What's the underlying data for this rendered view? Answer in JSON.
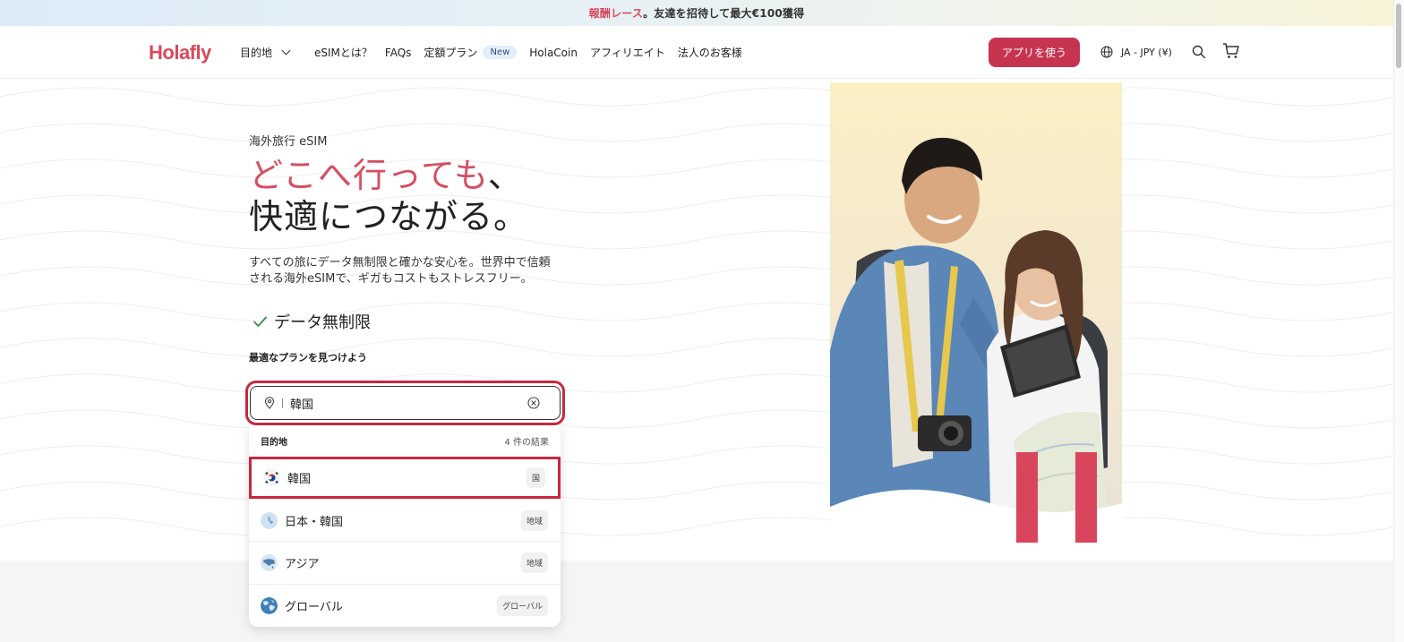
{
  "promo": {
    "accent": "報酬レース",
    "rest": "。友達を招待して最大€100獲得"
  },
  "header": {
    "logo": "Holafly",
    "nav": [
      {
        "label": "目的地"
      },
      {
        "label": "eSIMとは？"
      },
      {
        "label": "FAQs"
      },
      {
        "label": "定額プラン",
        "badge": "New"
      },
      {
        "label": "HolaCoin"
      },
      {
        "label": "アフィリエイト"
      },
      {
        "label": "法人のお客様"
      }
    ],
    "app_button": "アプリを使う",
    "language": "JA - JPY (¥)"
  },
  "hero": {
    "eyebrow": "海外旅行 eSIM",
    "headline_pink": "どこへ行っても",
    "headline_comma": "、",
    "headline_line2": "快適につながる。",
    "description": "すべての旅にデータ無制限と確かな安心を。世界中で信頼される海外eSIMで、ギガもコストもストレスフリー。",
    "feature": "データ無制限",
    "find_label": "最適なプランを見つけよう"
  },
  "search": {
    "value": "韓国"
  },
  "dropdown": {
    "heading": "目的地",
    "count": "4 件の結果",
    "items": [
      {
        "name": "韓国",
        "tag": "国",
        "flag": "korea-flag"
      },
      {
        "name": "日本・韓国",
        "tag": "地域",
        "flag": "globe-japan-korea"
      },
      {
        "name": "アジア",
        "tag": "地域",
        "flag": "globe-asia"
      },
      {
        "name": "グローバル",
        "tag": "グローバル",
        "flag": "globe-world"
      }
    ]
  },
  "colors": {
    "brand": "#d84a5c",
    "button": "#c73450",
    "highlight": "#c8283f"
  }
}
